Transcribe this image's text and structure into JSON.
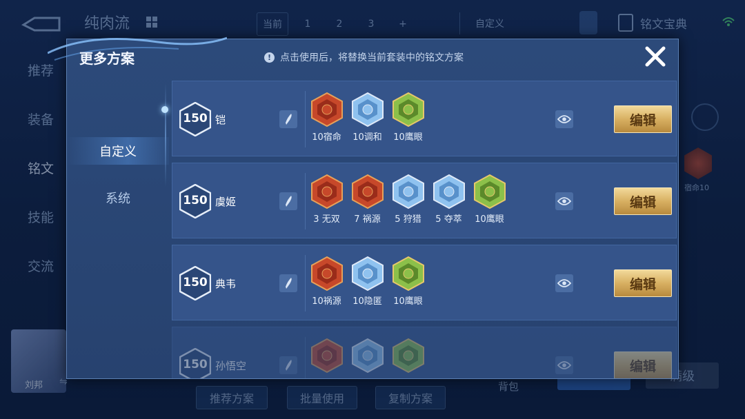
{
  "background": {
    "title": "纯肉流",
    "tabs": [
      "当前",
      "1",
      "2",
      "3",
      "+"
    ],
    "custom_label": "自定义",
    "codex_label": "铭文宝典",
    "nav": [
      "推荐",
      "装备",
      "铭文",
      "技能",
      "交流"
    ],
    "active_nav": "铭文",
    "hero_name": "刘邦",
    "side_rune_label": "宿命10",
    "bottom_buttons": [
      "推荐方案",
      "批量使用",
      "复制方案"
    ],
    "bag_label": "背包",
    "max_label": "满级"
  },
  "modal": {
    "title": "更多方案",
    "hint": "点击使用后，将替换当前套装中的铭文方案",
    "side_tabs": [
      "自定义",
      "系统"
    ],
    "active_tab": "自定义",
    "edit_label": "编辑",
    "rows": [
      {
        "level": "150",
        "name": "铠",
        "runes": [
          {
            "label": "10宿命",
            "color": "red"
          },
          {
            "label": "10调和",
            "color": "blue"
          },
          {
            "label": "10鹰眼",
            "color": "green"
          }
        ]
      },
      {
        "level": "150",
        "name": "虞姬",
        "runes": [
          {
            "label": "3 无双",
            "color": "red"
          },
          {
            "label": "7 祸源",
            "color": "red"
          },
          {
            "label": "5 狩猎",
            "color": "blue"
          },
          {
            "label": "5 夺萃",
            "color": "blue"
          },
          {
            "label": "10鹰眼",
            "color": "green"
          }
        ]
      },
      {
        "level": "150",
        "name": "典韦",
        "runes": [
          {
            "label": "10祸源",
            "color": "red"
          },
          {
            "label": "10隐匿",
            "color": "blue"
          },
          {
            "label": "10鹰眼",
            "color": "green"
          }
        ]
      },
      {
        "level": "150",
        "name": "孙悟空",
        "runes": [
          {
            "label": "",
            "color": "red"
          },
          {
            "label": "",
            "color": "blue"
          },
          {
            "label": "",
            "color": "green"
          }
        ]
      }
    ]
  },
  "colors": {
    "rune_red": "#c7482a",
    "rune_blue": "#6fa4d6",
    "rune_green": "#7cae3c",
    "gold": "#d8b062",
    "modal_bg": "#2c4a7a"
  }
}
